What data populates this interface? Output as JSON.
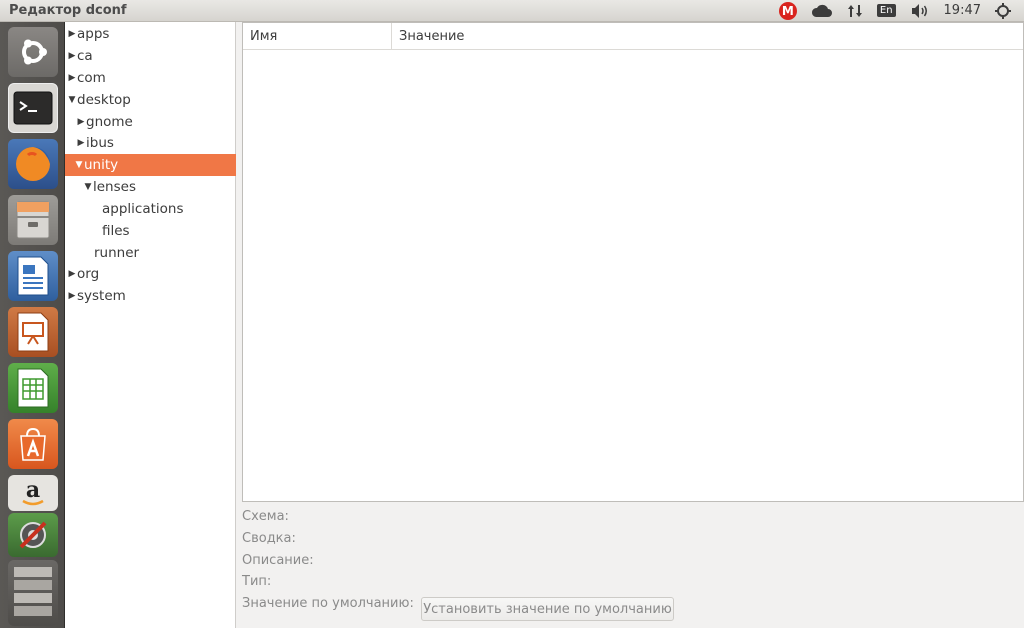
{
  "window": {
    "title": "Редактор dconf"
  },
  "tray": {
    "mega_letter": "M",
    "keyboard_layout": "En",
    "clock": "19:47"
  },
  "launcher": {
    "items": [
      {
        "icon": "ubuntu-dash-icon",
        "label": "Dash"
      },
      {
        "icon": "terminal-icon",
        "label": "Terminal"
      },
      {
        "icon": "firefox-icon",
        "label": "Firefox"
      },
      {
        "icon": "file-manager-icon",
        "label": "Files"
      },
      {
        "icon": "libreoffice-writer-icon",
        "label": "Writer"
      },
      {
        "icon": "libreoffice-impress-icon",
        "label": "Impress"
      },
      {
        "icon": "libreoffice-calc-icon",
        "label": "Calc"
      },
      {
        "icon": "software-center-icon",
        "label": "Software Center"
      },
      {
        "icon": "amazon-icon",
        "label": "Amazon",
        "glyph": "a"
      },
      {
        "icon": "system-settings-icon",
        "label": "Settings"
      },
      {
        "icon": "trash-icon",
        "label": "Trash"
      }
    ]
  },
  "tree": {
    "items": [
      {
        "label": "apps",
        "expander": "▶",
        "depth": 0,
        "selected": false
      },
      {
        "label": "ca",
        "expander": "▶",
        "depth": 0,
        "selected": false
      },
      {
        "label": "com",
        "expander": "▶",
        "depth": 0,
        "selected": false
      },
      {
        "label": "desktop",
        "expander": "▼",
        "depth": 0,
        "selected": false
      },
      {
        "label": "gnome",
        "expander": "▶",
        "depth": 1,
        "selected": false
      },
      {
        "label": "ibus",
        "expander": "▶",
        "depth": 1,
        "selected": false
      },
      {
        "label": "unity",
        "expander": "▼",
        "depth": 1,
        "selected": true
      },
      {
        "label": "lenses",
        "expander": "▼",
        "depth": 2,
        "selected": false
      },
      {
        "label": "applications",
        "expander": "",
        "depth": 3,
        "selected": false
      },
      {
        "label": "files",
        "expander": "",
        "depth": 3,
        "selected": false
      },
      {
        "label": "runner",
        "expander": "",
        "depth": 2,
        "selected": false
      },
      {
        "label": "org",
        "expander": "▶",
        "depth": 0,
        "selected": false
      },
      {
        "label": "system",
        "expander": "▶",
        "depth": 0,
        "selected": false
      }
    ]
  },
  "list": {
    "columns": {
      "name": "Имя",
      "value": "Значение"
    },
    "rows": []
  },
  "details": {
    "schema_label": "Схема:",
    "summary_label": "Сводка:",
    "description_label": "Описание:",
    "type_label": "Тип:",
    "default_label": "Значение по умолчанию:",
    "set_default_button": "Установить значение по умолчанию"
  }
}
